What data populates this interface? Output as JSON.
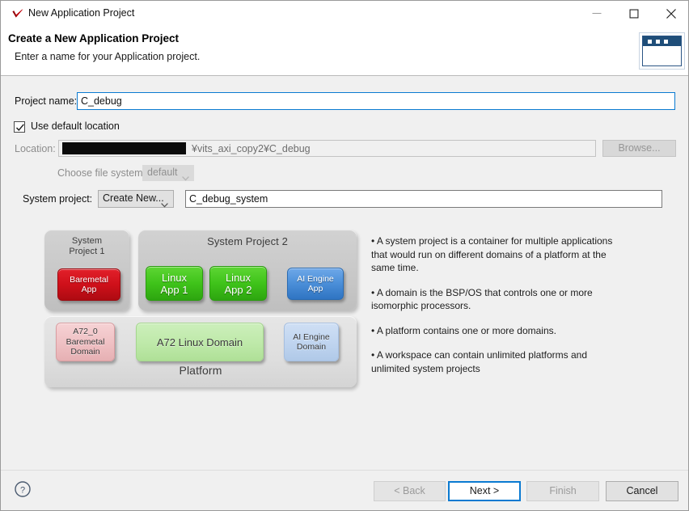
{
  "window": {
    "title": "New Application Project",
    "icon": "xilinx-check-icon",
    "minimize_label": "minimize-icon",
    "maximize_label": "maximize-icon",
    "close_label": "close-icon"
  },
  "header": {
    "title": "Create a New Application Project",
    "subtitle": "Enter a name for your Application project."
  },
  "form": {
    "project_name_label": "Project name:",
    "project_name_value": "C_debug",
    "use_default_location_label": "Use default location",
    "use_default_location_checked": true,
    "location_label": "Location:",
    "location_value": "¥vits_axi_copy2¥C_debug",
    "location_redacted": true,
    "browse_label": "Browse...",
    "browse_enabled": false,
    "filesystem_label": "Choose file system:",
    "filesystem_value": "default",
    "filesystem_enabled": false,
    "system_project_label": "System project:",
    "system_project_select_value": "Create New...",
    "system_project_name_value": "C_debug_system"
  },
  "diagram": {
    "system_project_1_title": "System\nProject 1",
    "system_project_2_title": "System Project 2",
    "platform_title": "Platform",
    "apps": [
      {
        "label": "Baremetal\nApp",
        "color": "#cf101a"
      },
      {
        "label": "Linux\nApp 1",
        "color": "#3fc31a"
      },
      {
        "label": "Linux\nApp 2",
        "color": "#3fc31a"
      },
      {
        "label": "AI Engine\nApp",
        "color": "#4a8ed8"
      }
    ],
    "domains": [
      {
        "label": "A72_0\nBaremetal\nDomain",
        "color": "#efc0c3"
      },
      {
        "label": "A72 Linux Domain",
        "color": "#bee9a9"
      },
      {
        "label": "AI Engine\nDomain",
        "color": "#bfd4ef"
      }
    ]
  },
  "bullets": [
    "• A system project is a container for multiple applications that would run on different domains of a platform at the same time.",
    "• A domain is the BSP/OS that controls one or more isomorphic processors.",
    "• A platform contains one or more domains.",
    "• A workspace can contain unlimited platforms and unlimited system projects"
  ],
  "footer": {
    "help_label": "help-icon",
    "back_label": "< Back",
    "back_enabled": false,
    "next_label": "Next >",
    "next_is_default": true,
    "finish_label": "Finish",
    "finish_enabled": false,
    "cancel_label": "Cancel"
  },
  "colors": {
    "accent": "#0a7ad1",
    "dialog_bg": "#f0f0f0",
    "header_bg": "#ffffff",
    "header_graphic": "#1f4e79"
  }
}
